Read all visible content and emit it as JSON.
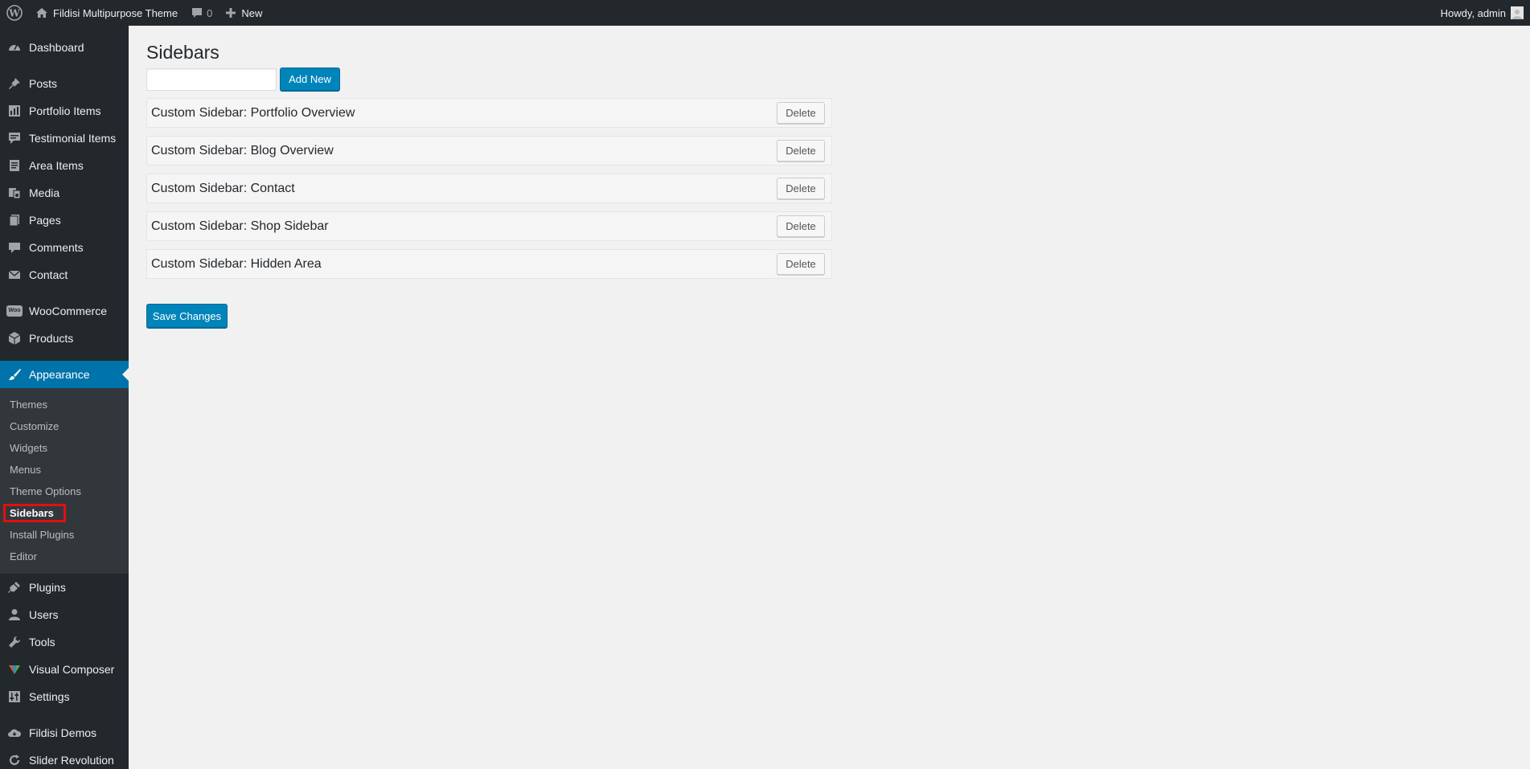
{
  "adminbar": {
    "site_name": "Fildisi Multipurpose Theme",
    "comments_count": "0",
    "new_label": "New",
    "howdy": "Howdy, admin"
  },
  "sidebar": {
    "items": [
      {
        "label": "Dashboard",
        "icon": "dashboard-icon"
      },
      {
        "label": "Posts",
        "icon": "pin-icon"
      },
      {
        "label": "Portfolio Items",
        "icon": "portfolio-icon"
      },
      {
        "label": "Testimonial Items",
        "icon": "testimonial-icon"
      },
      {
        "label": "Area Items",
        "icon": "document-icon"
      },
      {
        "label": "Media",
        "icon": "media-icon"
      },
      {
        "label": "Pages",
        "icon": "pages-icon"
      },
      {
        "label": "Comments",
        "icon": "comment-icon"
      },
      {
        "label": "Contact",
        "icon": "mail-icon"
      },
      {
        "label": "WooCommerce",
        "icon": "woocommerce-icon"
      },
      {
        "label": "Products",
        "icon": "box-icon"
      },
      {
        "label": "Appearance",
        "icon": "paintbrush-icon"
      },
      {
        "label": "Plugins",
        "icon": "plug-icon"
      },
      {
        "label": "Users",
        "icon": "user-icon"
      },
      {
        "label": "Tools",
        "icon": "wrench-icon"
      },
      {
        "label": "Visual Composer",
        "icon": "visual-composer-icon"
      },
      {
        "label": "Settings",
        "icon": "settings-icon"
      },
      {
        "label": "Fildisi Demos",
        "icon": "cloud-icon"
      },
      {
        "label": "Slider Revolution",
        "icon": "refresh-icon"
      }
    ],
    "appearance_submenu": [
      "Themes",
      "Customize",
      "Widgets",
      "Menus",
      "Theme Options",
      "Sidebars",
      "Install Plugins",
      "Editor"
    ]
  },
  "main": {
    "title": "Sidebars",
    "new_sidebar_input": {
      "value": "",
      "placeholder": ""
    },
    "add_new_label": "Add New",
    "sidebars": [
      "Custom Sidebar: Portfolio Overview",
      "Custom Sidebar: Blog Overview",
      "Custom Sidebar: Contact",
      "Custom Sidebar: Shop Sidebar",
      "Custom Sidebar: Hidden Area"
    ],
    "delete_label": "Delete",
    "save_label": "Save Changes"
  },
  "colors": {
    "admin_dark": "#23282d",
    "submenu_bg": "#32373c",
    "accent": "#0073aa",
    "button_primary": "#0085ba",
    "page_bg": "#f1f1f1",
    "highlight_red": "#e01010"
  }
}
